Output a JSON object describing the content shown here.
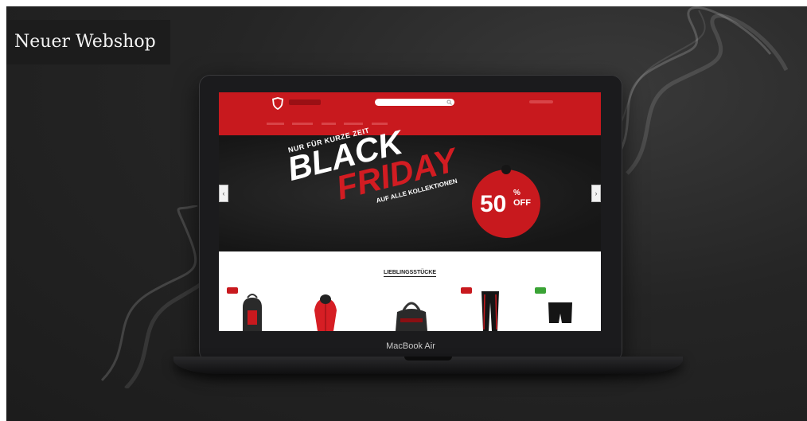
{
  "page": {
    "title": "Neuer Webshop"
  },
  "device": {
    "brand": "MacBook Air"
  },
  "hero": {
    "line1_prefix": "NUR FÜR ",
    "line1_bold": "KURZE ZEIT",
    "word1": "BLACK",
    "word2": "FRIDAY",
    "sub_prefix": "AUF ",
    "sub_bold": "ALLE KOLLEKTIONEN",
    "discount_number": "50",
    "discount_percent": "%",
    "discount_off": "OFF"
  },
  "section": {
    "title": "LIEBLINGSSTÜCKE"
  },
  "colors": {
    "brand_red": "#c8191e",
    "sale_green": "#3aa335",
    "background": "#222222"
  },
  "icons": [
    "logo-shield-icon",
    "search-icon",
    "chevron-left-icon",
    "chevron-right-icon"
  ]
}
